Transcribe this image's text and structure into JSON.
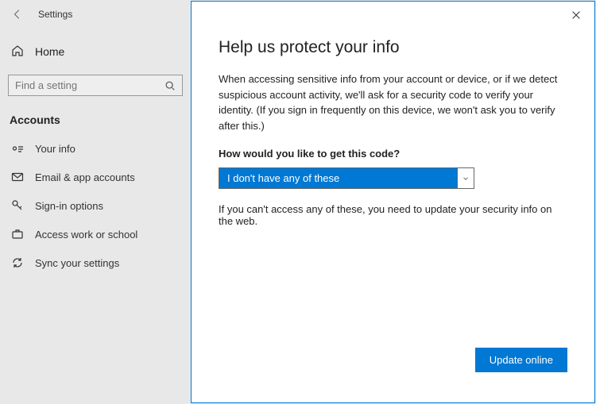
{
  "header": {
    "title": "Settings"
  },
  "home_label": "Home",
  "search": {
    "placeholder": "Find a setting"
  },
  "section": "Accounts",
  "nav": {
    "your_info": "Your info",
    "email_accounts": "Email & app accounts",
    "signin": "Sign-in options",
    "work_school": "Access work or school",
    "sync": "Sync your settings"
  },
  "dialog": {
    "title": "Help us protect your info",
    "body": "When accessing sensitive info from your account or device, or if we detect suspicious account activity, we'll ask for a security code to verify your identity. (If you sign in frequently on this device, we won't ask you to verify after this.)",
    "question": "How would you like to get this code?",
    "selected": "I don't have any of these",
    "note": "If you can't access any of these, you need to update your security info on the web.",
    "action": "Update online"
  }
}
